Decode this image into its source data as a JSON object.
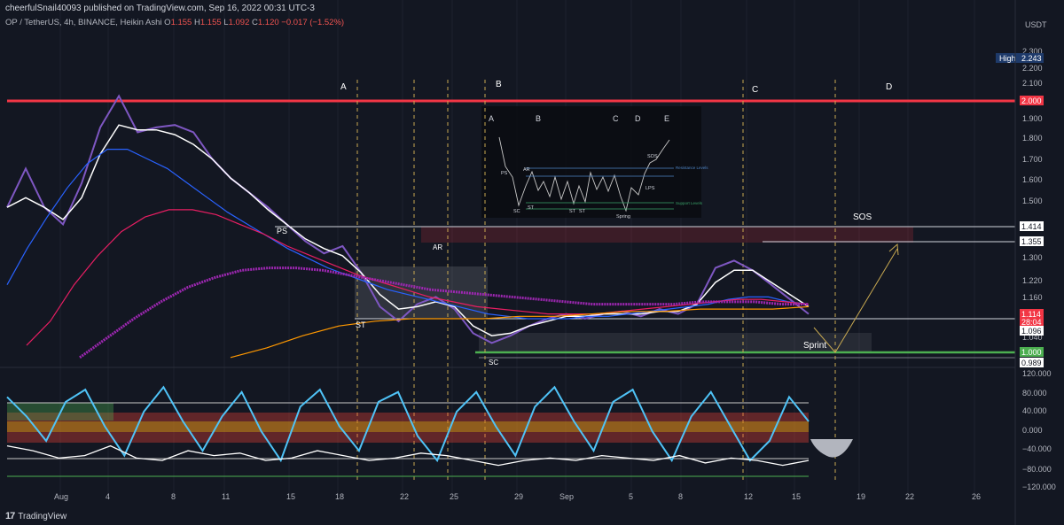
{
  "header": {
    "published": "cheerfulSnail40093 published on TradingView.com, Sep 16, 2022 00:31 UTC-3",
    "symbol": "OP / TetherUS, 4h, BINANCE, Heikin Ashi",
    "ohlc": [
      "O",
      "1.155",
      "H",
      "1.155",
      "L",
      "1.092",
      "C",
      "1.120",
      "−0.017 (−1.52%)"
    ]
  },
  "brand": {
    "name": "TradingView",
    "logo": "17"
  },
  "colors": {
    "bg": "#131722",
    "grid": "#1e222d",
    "red_level": "#f23645",
    "green_level": "#4caf50",
    "price": "#7e57c2",
    "ma_white": "#ffffff",
    "ma_blue": "#2962ff",
    "ma_red": "#e91e63",
    "ma_purple": "#9c27b0",
    "ma_orange": "#ff9800",
    "gold_arrow": "#c8a951"
  },
  "chart_data": [
    {
      "type": "line",
      "panel": "price",
      "currency": "USDT",
      "x_ticks": [
        "Aug",
        "4",
        "8",
        "11",
        "15",
        "18",
        "22",
        "25",
        "29",
        "Sep",
        "5",
        "8",
        "12",
        "15",
        "19",
        "22",
        "26"
      ],
      "y_ticks": [
        "2.300",
        "2.200",
        "2.100",
        "1.900",
        "1.800",
        "1.700",
        "1.600",
        "1.500",
        "1.300",
        "1.160",
        "1.040"
      ],
      "ylim": [
        0.97,
        2.33
      ],
      "series": [
        {
          "values": [
            1.62,
            1.78,
            1.62,
            1.55,
            1.72,
            1.95,
            2.08,
            1.93,
            1.95,
            1.96,
            1.93,
            1.82,
            1.74,
            1.68,
            1.62,
            1.55,
            1.48,
            1.43,
            1.46,
            1.35,
            1.21,
            1.15,
            1.22,
            1.25,
            1.2,
            1.1,
            1.06,
            1.09,
            1.13,
            1.16,
            1.18,
            1.16,
            1.18,
            1.19,
            1.17,
            1.2,
            1.18,
            1.22,
            1.37,
            1.4,
            1.36,
            1.3,
            1.24,
            1.18
          ]
        },
        {
          "values": [
            1.62,
            1.66,
            1.62,
            1.57,
            1.66,
            1.84,
            1.96,
            1.94,
            1.94,
            1.92,
            1.88,
            1.82,
            1.74,
            1.68,
            1.61,
            1.55,
            1.49,
            1.45,
            1.42,
            1.35,
            1.26,
            1.2,
            1.21,
            1.23,
            1.21,
            1.13,
            1.09,
            1.1,
            1.13,
            1.15,
            1.17,
            1.17,
            1.18,
            1.18,
            1.18,
            1.19,
            1.19,
            1.22,
            1.31,
            1.36,
            1.36,
            1.31,
            1.26,
            1.21
          ]
        },
        {
          "values": [
            1.3,
            1.45,
            1.58,
            1.7,
            1.8,
            1.86,
            1.86,
            1.82,
            1.78,
            1.72,
            1.66,
            1.6,
            1.55,
            1.5,
            1.45,
            1.41,
            1.37,
            1.34,
            1.31,
            1.28,
            1.26,
            1.24,
            1.22,
            1.2,
            1.18,
            1.17,
            1.16,
            1.16,
            1.16,
            1.17,
            1.17,
            1.18,
            1.19,
            1.2,
            1.21,
            1.22,
            1.24,
            1.25,
            1.25,
            1.23,
            1.22
          ]
        },
        {
          "values": [
            1.05,
            1.15,
            1.3,
            1.42,
            1.52,
            1.58,
            1.61,
            1.61,
            1.59,
            1.55,
            1.51,
            1.46,
            1.42,
            1.38,
            1.34,
            1.31,
            1.28,
            1.25,
            1.23,
            1.21,
            1.2,
            1.19,
            1.18,
            1.18,
            1.18,
            1.19,
            1.2,
            1.21,
            1.22,
            1.23,
            1.24,
            1.24,
            1.23,
            1.22
          ]
        },
        {
          "values": [
            1.0,
            1.08,
            1.16,
            1.23,
            1.29,
            1.33,
            1.36,
            1.37,
            1.37,
            1.36,
            1.34,
            1.32,
            1.3,
            1.28,
            1.27,
            1.26,
            1.25,
            1.24,
            1.23,
            1.22,
            1.22,
            1.22,
            1.22,
            1.23,
            1.23,
            1.23,
            1.22,
            1.22
          ]
        },
        {
          "values": [
            1.0,
            1.04,
            1.09,
            1.13,
            1.15,
            1.16,
            1.16,
            1.16,
            1.17,
            1.17,
            1.18,
            1.19,
            1.19,
            1.2,
            1.2,
            1.2,
            1.21
          ]
        }
      ],
      "price_labels": [
        {
          "text": "High",
          "value": "2.243"
        },
        {
          "text": "",
          "value": "2.000"
        },
        {
          "text": "",
          "value": "1.414"
        },
        {
          "text": "",
          "value": "1.355"
        },
        {
          "text": "",
          "value": "1.220"
        },
        {
          "text": "",
          "value": "1.114"
        },
        {
          "text": "",
          "value": "28:04"
        },
        {
          "text": "",
          "value": "1.096"
        },
        {
          "text": "",
          "value": "1.000"
        },
        {
          "text": "",
          "value": "0.989"
        }
      ],
      "annotations": [
        "A",
        "B",
        "C",
        "D",
        "PS",
        "AR",
        "ST",
        "SC",
        "SOS",
        "Sprint"
      ],
      "inset": {
        "phases": [
          "A",
          "B",
          "C",
          "D",
          "E"
        ],
        "labels": [
          "PS",
          "AR",
          "SC",
          "ST",
          "ST",
          "ST",
          "Spring",
          "LPS",
          "SOS"
        ],
        "levels": [
          "Resistance Levels",
          "Support Levels"
        ]
      }
    },
    {
      "type": "line",
      "panel": "oscillator",
      "y_ticks": [
        "120.000",
        "80.000",
        "40.000",
        "0.000",
        "−40.000",
        "−80.000",
        "−120.000"
      ],
      "ylim": [
        -125,
        125
      ],
      "series": [
        {
          "values": [
            70,
            30,
            -20,
            60,
            85,
            10,
            -50,
            40,
            90,
            20,
            -40,
            30,
            80,
            0,
            -60,
            50,
            85,
            10,
            -40,
            60,
            80,
            -10,
            -60,
            40,
            80,
            10,
            -50,
            50,
            90,
            20,
            -40,
            60,
            85,
            0,
            -60,
            30,
            80,
            10,
            -60,
            -20,
            70,
            20
          ]
        },
        {
          "values": [
            -30,
            -40,
            -55,
            -50,
            -30,
            -55,
            -60,
            -40,
            -50,
            -45,
            -60,
            -55,
            -40,
            -50,
            -60,
            -55,
            -45,
            -50,
            -60,
            -70,
            -60,
            -55,
            -60,
            -50,
            -55,
            -60,
            -50,
            -65,
            -55,
            -60,
            -70,
            -60
          ]
        }
      ]
    }
  ]
}
